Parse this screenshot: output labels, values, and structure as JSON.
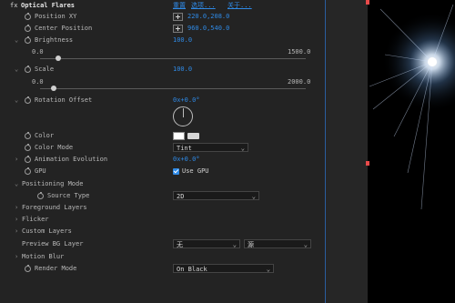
{
  "effect": {
    "fx": "fx",
    "title": "Optical Flares",
    "links": [
      "重置",
      "选项...",
      "关于..."
    ]
  },
  "props": {
    "position_xy": {
      "label": "Position XY",
      "value": "220.0,208.0"
    },
    "center_position": {
      "label": "Center Position",
      "value": "960.0,540.0"
    },
    "brightness": {
      "label": "Brightness",
      "value": "100.0",
      "min": "0.0",
      "max": "1500.0",
      "fraction": 0.067
    },
    "scale": {
      "label": "Scale",
      "value": "100.0",
      "min": "0.0",
      "max": "2000.0",
      "fraction": 0.05
    },
    "rotation_offset": {
      "label": "Rotation Offset",
      "value": "0x+0.0°"
    },
    "color": {
      "label": "Color",
      "swatch": "#ffffff"
    },
    "color_mode": {
      "label": "Color Mode",
      "value": "Tint"
    },
    "animation_evolution": {
      "label": "Animation Evolution",
      "value": "0x+0.0°"
    },
    "gpu": {
      "label": "GPU",
      "checkbox_label": "Use GPU",
      "checked": true
    },
    "positioning_mode": {
      "label": "Positioning Mode"
    },
    "source_type": {
      "label": "Source Type",
      "value": "2D"
    },
    "foreground_layers": {
      "label": "Foreground Layers"
    },
    "flicker": {
      "label": "Flicker"
    },
    "custom_layers": {
      "label": "Custom Layers"
    },
    "preview_bg_layer": {
      "label": "Preview BG Layer",
      "value1": "无",
      "value2": "源"
    },
    "motion_blur": {
      "label": "Motion Blur"
    },
    "render_mode": {
      "label": "Render Mode",
      "value": "On Black"
    }
  },
  "colors": {
    "accent": "#2f8ae6",
    "background": "#232323",
    "viewer": "#000000",
    "marker": "#e84a4a"
  }
}
